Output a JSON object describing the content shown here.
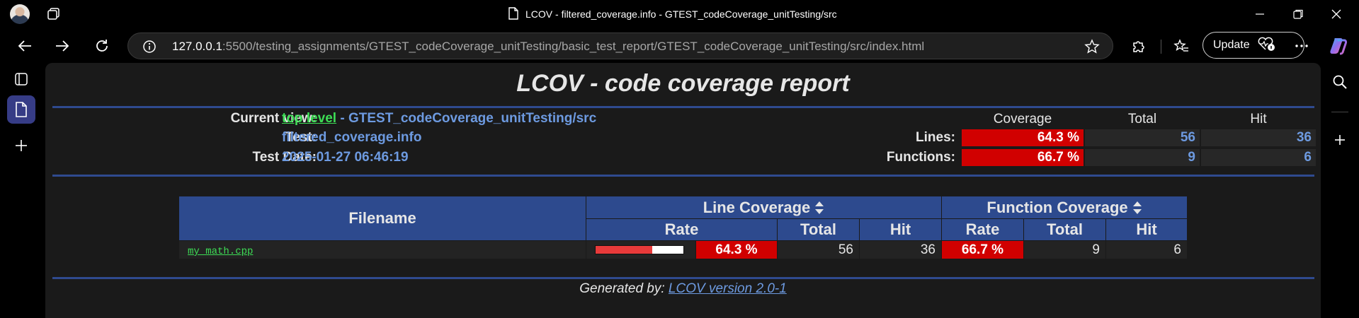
{
  "browser": {
    "tab_title": "LCOV - filtered_coverage.info - GTEST_codeCoverage_unitTesting/src",
    "url_host": "127.0.0.1",
    "url_rest": ":5500/testing_assignments/GTEST_codeCoverage_unitTesting/basic_test_report/GTEST_codeCoverage_unitTesting/src/index.html",
    "update_label": "Update"
  },
  "report": {
    "title": "LCOV - code coverage report",
    "current_view_label": "Current view:",
    "top_level_link": "top level",
    "current_view_rest": " - GTEST_codeCoverage_unitTesting/src",
    "test_label": "Test:",
    "test_value": "filtered_coverage.info",
    "test_date_label": "Test Date:",
    "test_date_value": "2025-01-27 06:46:19"
  },
  "summary": {
    "col_coverage": "Coverage",
    "col_total": "Total",
    "col_hit": "Hit",
    "rows": [
      {
        "label": "Lines:",
        "coverage": "64.3 %",
        "total": "56",
        "hit": "36"
      },
      {
        "label": "Functions:",
        "coverage": "66.7 %",
        "total": "9",
        "hit": "6"
      }
    ]
  },
  "files_table": {
    "col_filename": "Filename",
    "col_line_coverage": "Line Coverage",
    "col_function_coverage": "Function Coverage",
    "col_rate": "Rate",
    "col_total": "Total",
    "col_hit": "Hit",
    "rows": [
      {
        "filename": "my_math.cpp",
        "line_rate_fraction": 0.643,
        "line_rate": "64.3 %",
        "line_total": "56",
        "line_hit": "36",
        "func_rate": "66.7 %",
        "func_total": "9",
        "func_hit": "6"
      }
    ]
  },
  "footer": {
    "generated_by": "Generated by: ",
    "lcov_link": "LCOV version 2.0-1"
  },
  "colors": {
    "low_coverage_red": "#d10000",
    "header_blue": "#2d4a8e",
    "link_green": "#3ddd55",
    "value_blue": "#6d9ae0"
  }
}
